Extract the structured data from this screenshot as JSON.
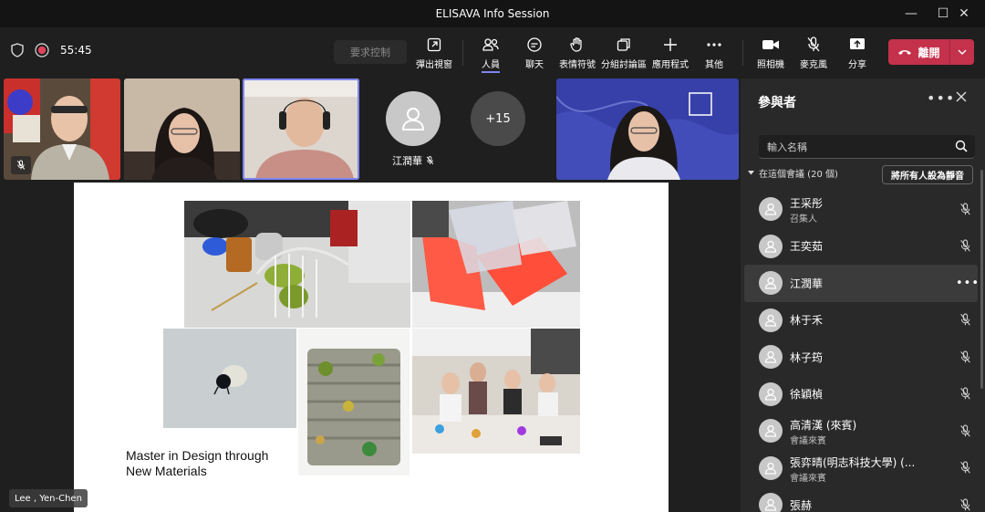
{
  "window": {
    "title": "ELISAVA Info Session",
    "minimize_glyph": "—",
    "maximize_glyph": "☐",
    "close_glyph": "✕"
  },
  "toolbar": {
    "timer": "55:45",
    "request_control": "要求控制",
    "popout_label": "彈出視窗",
    "people_label": "人員",
    "chat_label": "聊天",
    "reactions_label": "表情符號",
    "breakout_label": "分組討論區",
    "apps_label": "應用程式",
    "more_label": "其他",
    "camera_label": "照相機",
    "mic_label": "麥克風",
    "share_label": "分享",
    "leave_label": "離開"
  },
  "strip": {
    "avatar_name": "江潤華",
    "overflow": "+15"
  },
  "stage": {
    "caption_line1": "Master in Design through",
    "caption_line2": "New Materials",
    "presenter": "Lee , Yen-Chen"
  },
  "panel": {
    "title": "參與者",
    "more_glyph": "•••",
    "search_placeholder": "輸入名稱",
    "section_label": "在這個會議 (20 個)",
    "mute_all": "將所有人設為靜音",
    "participants": [
      {
        "name": "王采彤",
        "role": "召集人"
      },
      {
        "name": "王奕茹",
        "role": ""
      },
      {
        "name": "江潤華",
        "role": ""
      },
      {
        "name": "林于禾",
        "role": ""
      },
      {
        "name": "林子筠",
        "role": ""
      },
      {
        "name": "徐穎楨",
        "role": ""
      },
      {
        "name": "高清漢 (來賓)",
        "role": "會議來賓"
      },
      {
        "name": "張弈晴(明志科技大學) (...",
        "role": "會議來賓"
      },
      {
        "name": "張赫",
        "role": ""
      }
    ]
  },
  "colors": {
    "accent": "#7f85f5",
    "leave": "#c4314b",
    "panel_bg": "#292929",
    "app_bg": "#1f1f1f"
  },
  "icons": [
    "shield-icon",
    "record-icon",
    "popout-icon",
    "people-icon",
    "chat-icon",
    "reactions-icon",
    "breakout-icon",
    "plus-icon",
    "more-icon",
    "camera-icon",
    "mic-off-icon",
    "share-icon",
    "phone-icon",
    "chevron-down-icon",
    "search-icon",
    "close-icon",
    "person-icon"
  ]
}
